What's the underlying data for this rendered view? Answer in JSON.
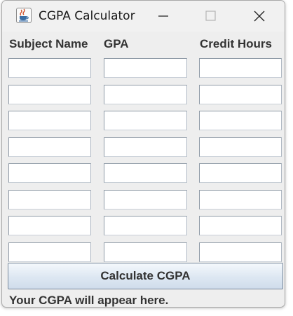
{
  "window": {
    "title": "CGPA Calculator",
    "icon": "java-cup-icon"
  },
  "headers": {
    "subject": "Subject Name",
    "gpa": "GPA",
    "credit": "Credit Hours"
  },
  "rows": [
    {
      "subject": "",
      "gpa": "",
      "credit": ""
    },
    {
      "subject": "",
      "gpa": "",
      "credit": ""
    },
    {
      "subject": "",
      "gpa": "",
      "credit": ""
    },
    {
      "subject": "",
      "gpa": "",
      "credit": ""
    },
    {
      "subject": "",
      "gpa": "",
      "credit": ""
    },
    {
      "subject": "",
      "gpa": "",
      "credit": ""
    },
    {
      "subject": "",
      "gpa": "",
      "credit": ""
    },
    {
      "subject": "",
      "gpa": "",
      "credit": ""
    }
  ],
  "actions": {
    "calculate_label": "Calculate CGPA"
  },
  "result": {
    "text": "Your CGPA will appear here."
  }
}
